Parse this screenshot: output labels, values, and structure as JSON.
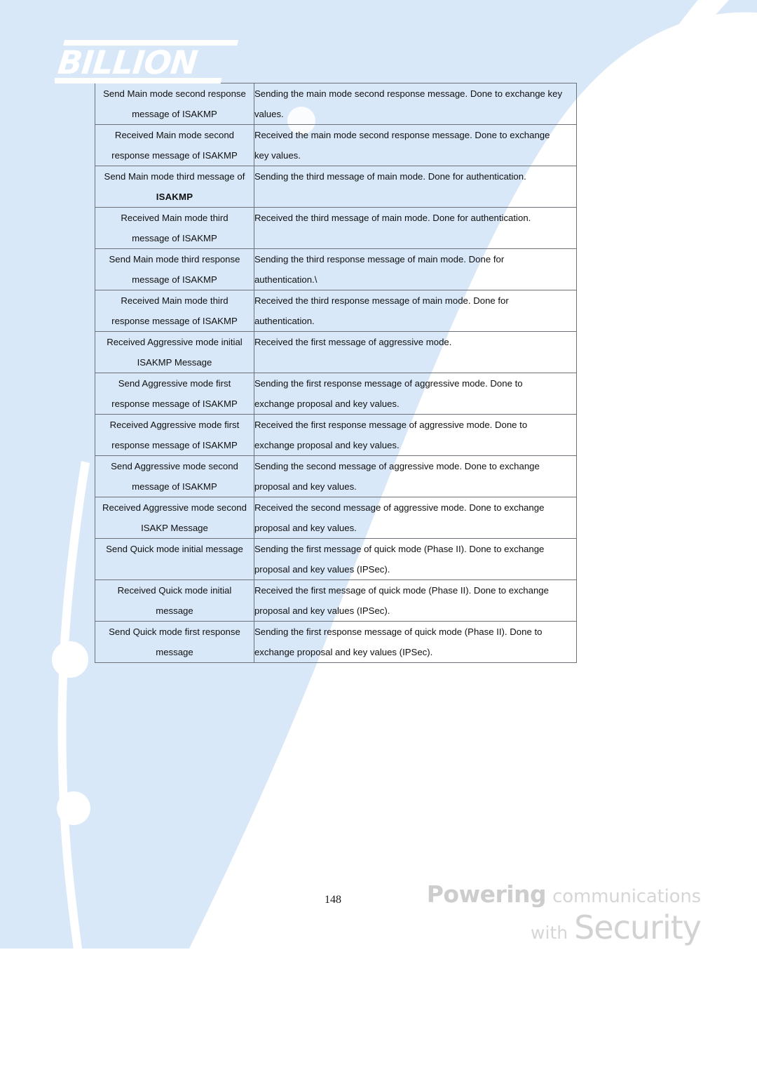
{
  "brand": {
    "logo_text": "BILLION",
    "tagline_bold": "Powering",
    "tagline_regular": "communications",
    "tagline_with": "with",
    "tagline_security": "Security"
  },
  "footer": {
    "page_number": "148"
  },
  "colors": {
    "background_blue": "#d9e8f8",
    "swoosh_white": "#ffffff",
    "table_border": "#6d7278",
    "text": "#101010",
    "tagline_gray": "#d2d2d2"
  },
  "table": {
    "rows": [
      {
        "term_lines": [
          "Send Main mode second response",
          "message of ISAKMP"
        ],
        "term_bold": [
          false,
          false
        ],
        "desc_lines": [
          "Sending the main mode second response message. Done to exchange key",
          "values."
        ]
      },
      {
        "term_lines": [
          "Received Main mode second",
          "response message of ISAKMP"
        ],
        "term_bold": [
          false,
          false
        ],
        "desc_lines": [
          "Received the main mode second response message. Done to exchange",
          "key values."
        ]
      },
      {
        "term_lines": [
          "Send Main mode third message of",
          "ISAKMP"
        ],
        "term_bold": [
          false,
          true
        ],
        "desc_lines": [
          "Sending the third message of main mode. Done for authentication."
        ]
      },
      {
        "term_lines": [
          "Received Main mode third",
          "message of ISAKMP"
        ],
        "term_bold": [
          false,
          false
        ],
        "desc_lines": [
          "Received the third message of main mode. Done for authentication."
        ]
      },
      {
        "term_lines": [
          "Send Main mode third response",
          "message of ISAKMP"
        ],
        "term_bold": [
          false,
          false
        ],
        "desc_lines": [
          "Sending the third response message of main mode. Done for",
          "authentication.\\"
        ]
      },
      {
        "term_lines": [
          "Received Main mode third",
          "response message of ISAKMP"
        ],
        "term_bold": [
          false,
          false
        ],
        "desc_lines": [
          "Received the third response message of main mode. Done for",
          "authentication."
        ]
      },
      {
        "term_lines": [
          "Received Aggressive mode initial",
          "ISAKMP Message"
        ],
        "term_bold": [
          false,
          false
        ],
        "desc_lines": [
          "Received the first message of aggressive mode."
        ]
      },
      {
        "term_lines": [
          "Send Aggressive mode first",
          "response message of ISAKMP"
        ],
        "term_bold": [
          false,
          false
        ],
        "desc_lines": [
          "Sending the first response message of aggressive mode. Done to",
          "exchange proposal and key values."
        ]
      },
      {
        "term_lines": [
          "Received Aggressive mode first",
          "response message of ISAKMP"
        ],
        "term_bold": [
          false,
          false
        ],
        "desc_lines": [
          "Received the first response message of aggressive mode. Done to",
          "exchange proposal and key values."
        ]
      },
      {
        "term_lines": [
          "Send Aggressive mode second",
          "message of ISAKMP"
        ],
        "term_bold": [
          false,
          false
        ],
        "desc_lines": [
          "Sending the second message of aggressive mode. Done to exchange",
          "proposal and key values."
        ]
      },
      {
        "term_lines": [
          "Received Aggressive mode second",
          "ISAKP Message"
        ],
        "term_bold": [
          false,
          false
        ],
        "desc_lines": [
          "Received the second message of aggressive mode. Done to exchange",
          "proposal and key values."
        ]
      },
      {
        "term_lines": [
          "Send Quick mode initial message"
        ],
        "term_bold": [
          false
        ],
        "desc_lines": [
          "Sending the first message of quick mode (Phase II). Done to exchange",
          "proposal and key values (IPSec)."
        ]
      },
      {
        "term_lines": [
          "Received Quick mode initial",
          "message"
        ],
        "term_bold": [
          false,
          false
        ],
        "desc_lines": [
          "Received the first message of quick mode (Phase II). Done to exchange",
          "proposal and key values (IPSec)."
        ]
      },
      {
        "term_lines": [
          "Send Quick mode first response",
          "message"
        ],
        "term_bold": [
          false,
          false
        ],
        "desc_lines": [
          "Sending the first response message of quick mode (Phase II). Done to",
          "exchange proposal and key values (IPSec)."
        ]
      }
    ]
  }
}
